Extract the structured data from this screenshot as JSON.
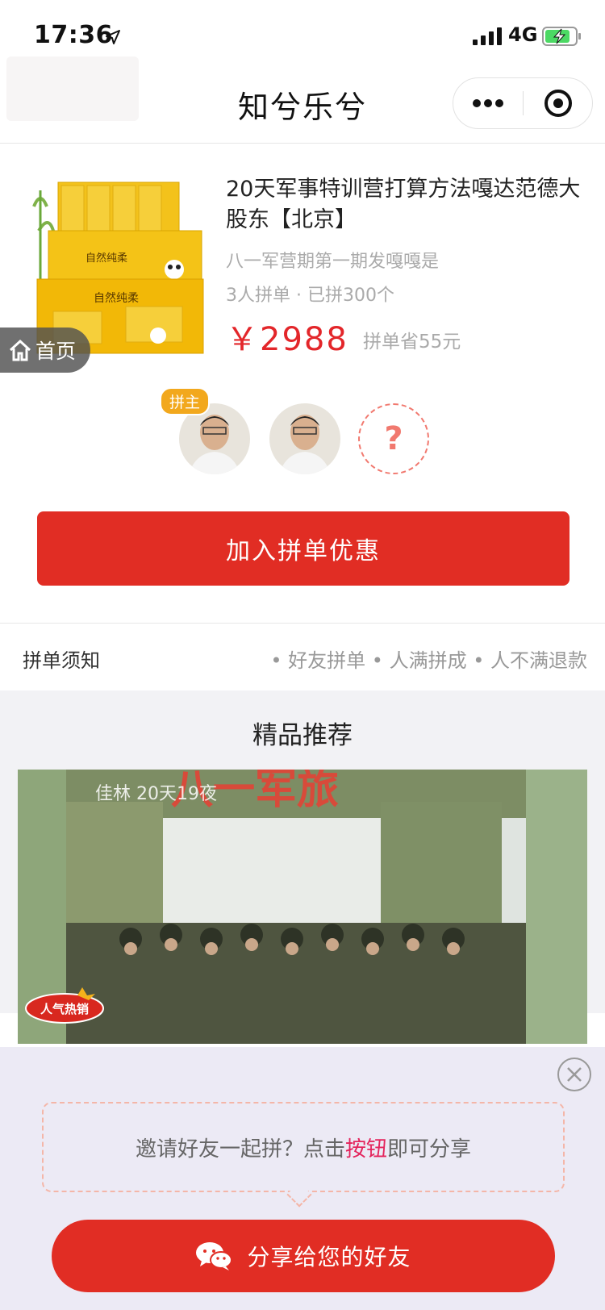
{
  "status_bar": {
    "time": "17:36",
    "network": "4G"
  },
  "nav": {
    "title": "知兮乐兮"
  },
  "product": {
    "title": "20天军事特训营打算方法嘎达范德大股东【北京】",
    "subtitle": "八一军营期第一期发嘎嘎是",
    "stats": "3人拼单 · 已拼300个",
    "price": "￥2988",
    "saving": "拼单省55元"
  },
  "home_float": {
    "label": "首页"
  },
  "members": {
    "owner_badge": "拼主",
    "unknown_symbol": "?"
  },
  "join_button": {
    "label": "加入拼单优惠"
  },
  "rules": {
    "title": "拼单须知",
    "items": "• 好友拼单 • 人满拼成 • 人不满退款"
  },
  "recommend": {
    "title": "精品推荐",
    "caption": "佳林 20天19夜",
    "sign_text": "八一军旅",
    "badge": "人气热销"
  },
  "share": {
    "tip_prefix": "邀请好友一起拼？点击",
    "tip_highlight": "按钮",
    "tip_suffix": "即可分享",
    "button_label": "分享给您的好友"
  },
  "colors": {
    "primary_red": "#e12d24",
    "price_red": "#e3262a",
    "highlight_pink": "#e4245c",
    "owner_badge": "#f2a81d"
  },
  "icons": [
    "location-arrow-icon",
    "signal-icon",
    "battery-charging-icon",
    "more-dots-icon",
    "close-target-icon",
    "home-icon",
    "close-circle-icon",
    "wechat-icon"
  ]
}
